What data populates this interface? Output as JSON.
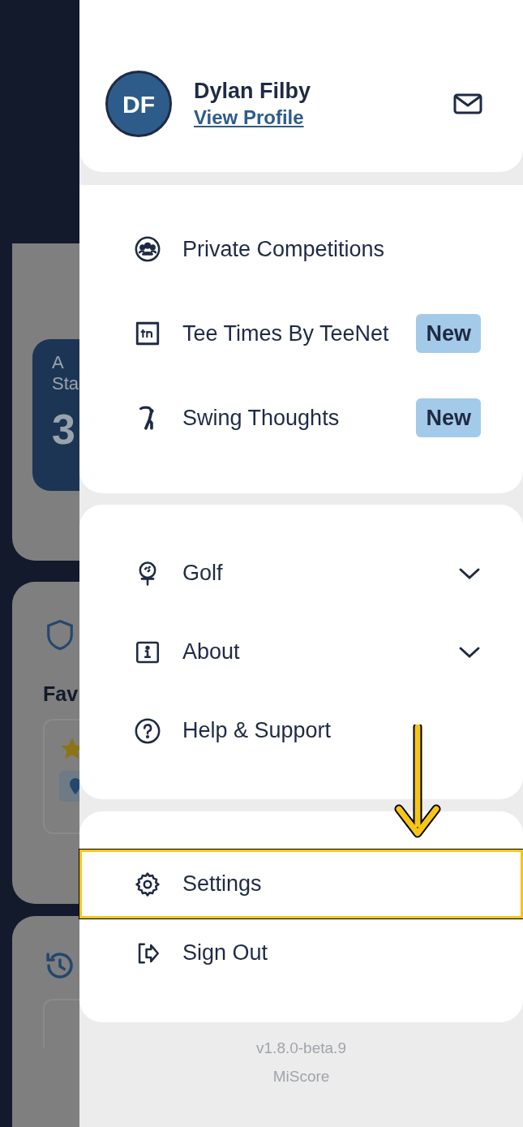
{
  "background": {
    "stats_card": {
      "label_lines": [
        "A",
        "Sta"
      ],
      "value": "3"
    },
    "favourites_title": "Fav"
  },
  "profile": {
    "initials": "DF",
    "name": "Dylan Filby",
    "link": "View Profile"
  },
  "menu_sections": [
    {
      "items": [
        {
          "label": "Private Competitions"
        },
        {
          "label": "Tee Times By TeeNet",
          "badge": "New"
        },
        {
          "label": "Swing Thoughts",
          "badge": "New"
        }
      ]
    },
    {
      "items": [
        {
          "label": "Golf",
          "expanded": false
        },
        {
          "label": "About",
          "expanded": false
        },
        {
          "label": "Help & Support"
        }
      ]
    },
    {
      "items": [
        {
          "label": "Settings",
          "highlighted": true
        },
        {
          "label": "Sign Out",
          "highlighted": false
        }
      ]
    }
  ],
  "footer": {
    "version": "v1.8.0-beta.9",
    "app_name": "MiScore"
  }
}
